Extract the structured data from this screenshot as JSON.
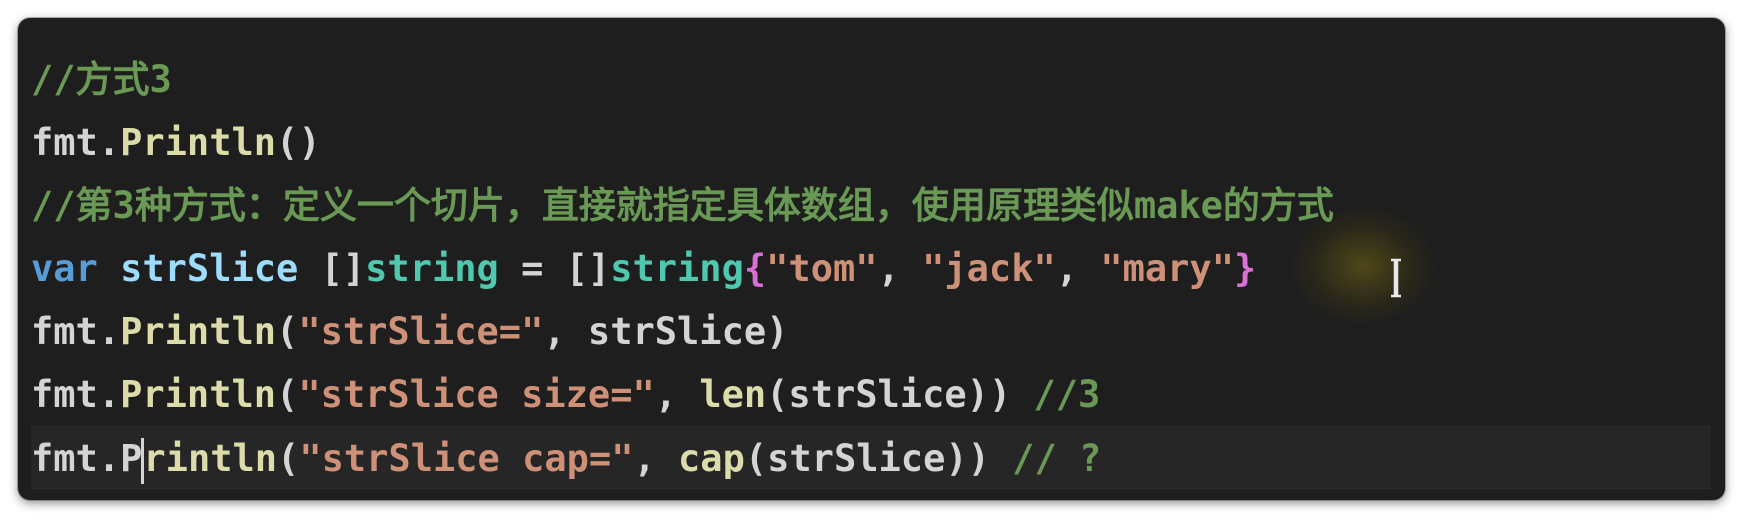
{
  "editor": {
    "lines": [
      {
        "tokens": [
          {
            "t": "//方式3",
            "k": "comment"
          }
        ]
      },
      {
        "tokens": [
          {
            "t": "fmt.",
            "k": "plain"
          },
          {
            "t": "Println",
            "k": "fn"
          },
          {
            "t": "()",
            "k": "plain"
          }
        ]
      },
      {
        "tokens": [
          {
            "t": "//第3种方式：定义一个切片，直接就指定具体数组，使用原理类似make的方式",
            "k": "comment"
          }
        ]
      },
      {
        "tokens": [
          {
            "t": "var",
            "k": "kw"
          },
          {
            "t": " ",
            "k": "plain"
          },
          {
            "t": "strSlice",
            "k": "var"
          },
          {
            "t": " []",
            "k": "plain"
          },
          {
            "t": "string",
            "k": "type"
          },
          {
            "t": " = []",
            "k": "plain"
          },
          {
            "t": "string",
            "k": "type"
          },
          {
            "t": "{",
            "k": "brace"
          },
          {
            "t": "\"tom\"",
            "k": "str"
          },
          {
            "t": ", ",
            "k": "plain"
          },
          {
            "t": "\"jack\"",
            "k": "str"
          },
          {
            "t": ", ",
            "k": "plain"
          },
          {
            "t": "\"mary\"",
            "k": "str"
          },
          {
            "t": "}",
            "k": "brace"
          }
        ]
      },
      {
        "tokens": [
          {
            "t": "fmt.",
            "k": "plain"
          },
          {
            "t": "Println",
            "k": "fn"
          },
          {
            "t": "(",
            "k": "plain"
          },
          {
            "t": "\"strSlice=\"",
            "k": "str"
          },
          {
            "t": ", strSlice)",
            "k": "plain"
          }
        ]
      },
      {
        "tokens": [
          {
            "t": "fmt.",
            "k": "plain"
          },
          {
            "t": "Println",
            "k": "fn"
          },
          {
            "t": "(",
            "k": "plain"
          },
          {
            "t": "\"strSlice size=\"",
            "k": "str"
          },
          {
            "t": ", ",
            "k": "plain"
          },
          {
            "t": "len",
            "k": "fn"
          },
          {
            "t": "(strSlice)) ",
            "k": "plain"
          },
          {
            "t": "//3",
            "k": "comment"
          }
        ]
      },
      {
        "current": true,
        "tokens": [
          {
            "t": "fmt.P",
            "k": "plain"
          },
          {
            "cursor": true
          },
          {
            "t": "rintln",
            "k": "fn"
          },
          {
            "t": "(",
            "k": "plain"
          },
          {
            "t": "\"strSlice cap=\"",
            "k": "str"
          },
          {
            "t": ", ",
            "k": "plain"
          },
          {
            "t": "cap",
            "k": "fn"
          },
          {
            "t": "(strSlice)) ",
            "k": "plain"
          },
          {
            "t": "// ?",
            "k": "comment"
          }
        ]
      }
    ]
  },
  "colors": {
    "background": "#1e1e1e",
    "comment": "#6a9955",
    "keyword": "#569cd6",
    "variable": "#9cdcfe",
    "type": "#4ec9b0",
    "string": "#ce9178",
    "function": "#dcdcaa",
    "plain": "#d4d4d4"
  },
  "icons": {
    "mouse_pointer": "text-ibeam-cursor-icon"
  }
}
